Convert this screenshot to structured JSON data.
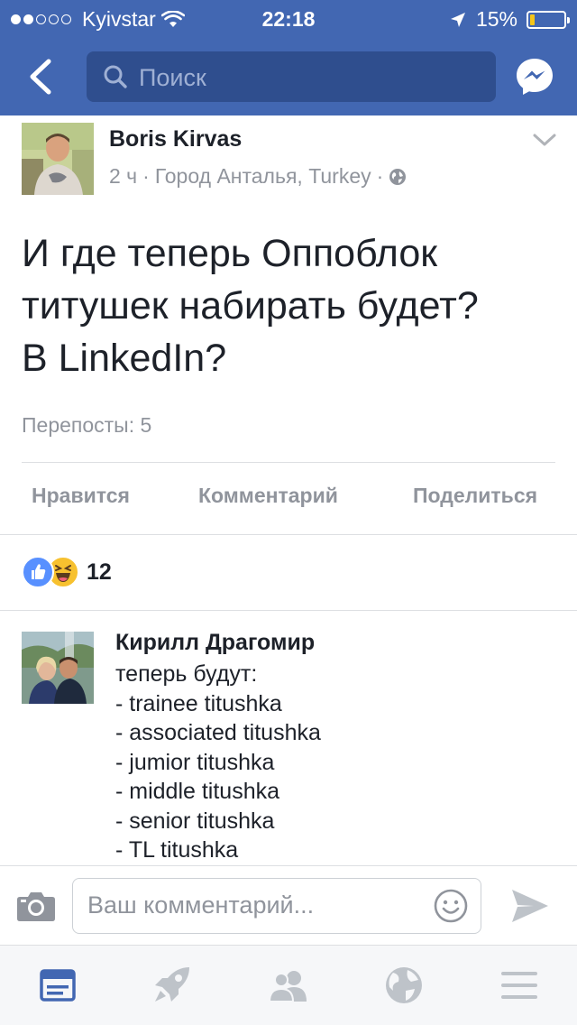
{
  "status_bar": {
    "carrier": "Kyivstar",
    "time": "22:18",
    "battery": "15%",
    "battery_level": 0.15
  },
  "nav": {
    "search_placeholder": "Поиск"
  },
  "post": {
    "author": "Boris Kirvas",
    "time": "2 ч",
    "location": "Город Анталья, Turkey",
    "text_lines": [
      "И где теперь Оппоблок",
      "титушек набирать будет?",
      "В LinkedIn?"
    ],
    "shares": "Перепосты: 5",
    "actions": {
      "like": "Нравится",
      "comment": "Комментарий",
      "share": "Поделиться"
    },
    "reactions_count": "12"
  },
  "comment": {
    "author": "Кирилл Драгомир",
    "lines": [
      "теперь будут:",
      "- trainee titushka",
      "- associated titushka",
      "- jumior titushka",
      "- middle titushka",
      "- senior titushka",
      "- TL titushka"
    ]
  },
  "composer": {
    "placeholder": "Ваш комментарий..."
  },
  "tabs": [
    "news-feed",
    "explore",
    "friends",
    "notifications",
    "menu"
  ],
  "colors": {
    "brand": "#4267b2",
    "search_bg": "#2f4e8e",
    "like_blue": "#5890ff",
    "haha_yellow": "#f7c12f",
    "muted": "#90949c",
    "battery_fill": "#f5c518"
  },
  "icons": [
    "back-arrow-icon",
    "search-icon",
    "messenger-icon",
    "chevron-down-icon",
    "globe-icon",
    "like-reaction-icon",
    "haha-reaction-icon",
    "camera-icon",
    "smiley-icon",
    "send-icon",
    "news-feed-icon",
    "rocket-icon",
    "friends-icon",
    "globe-tab-icon",
    "menu-icon"
  ]
}
